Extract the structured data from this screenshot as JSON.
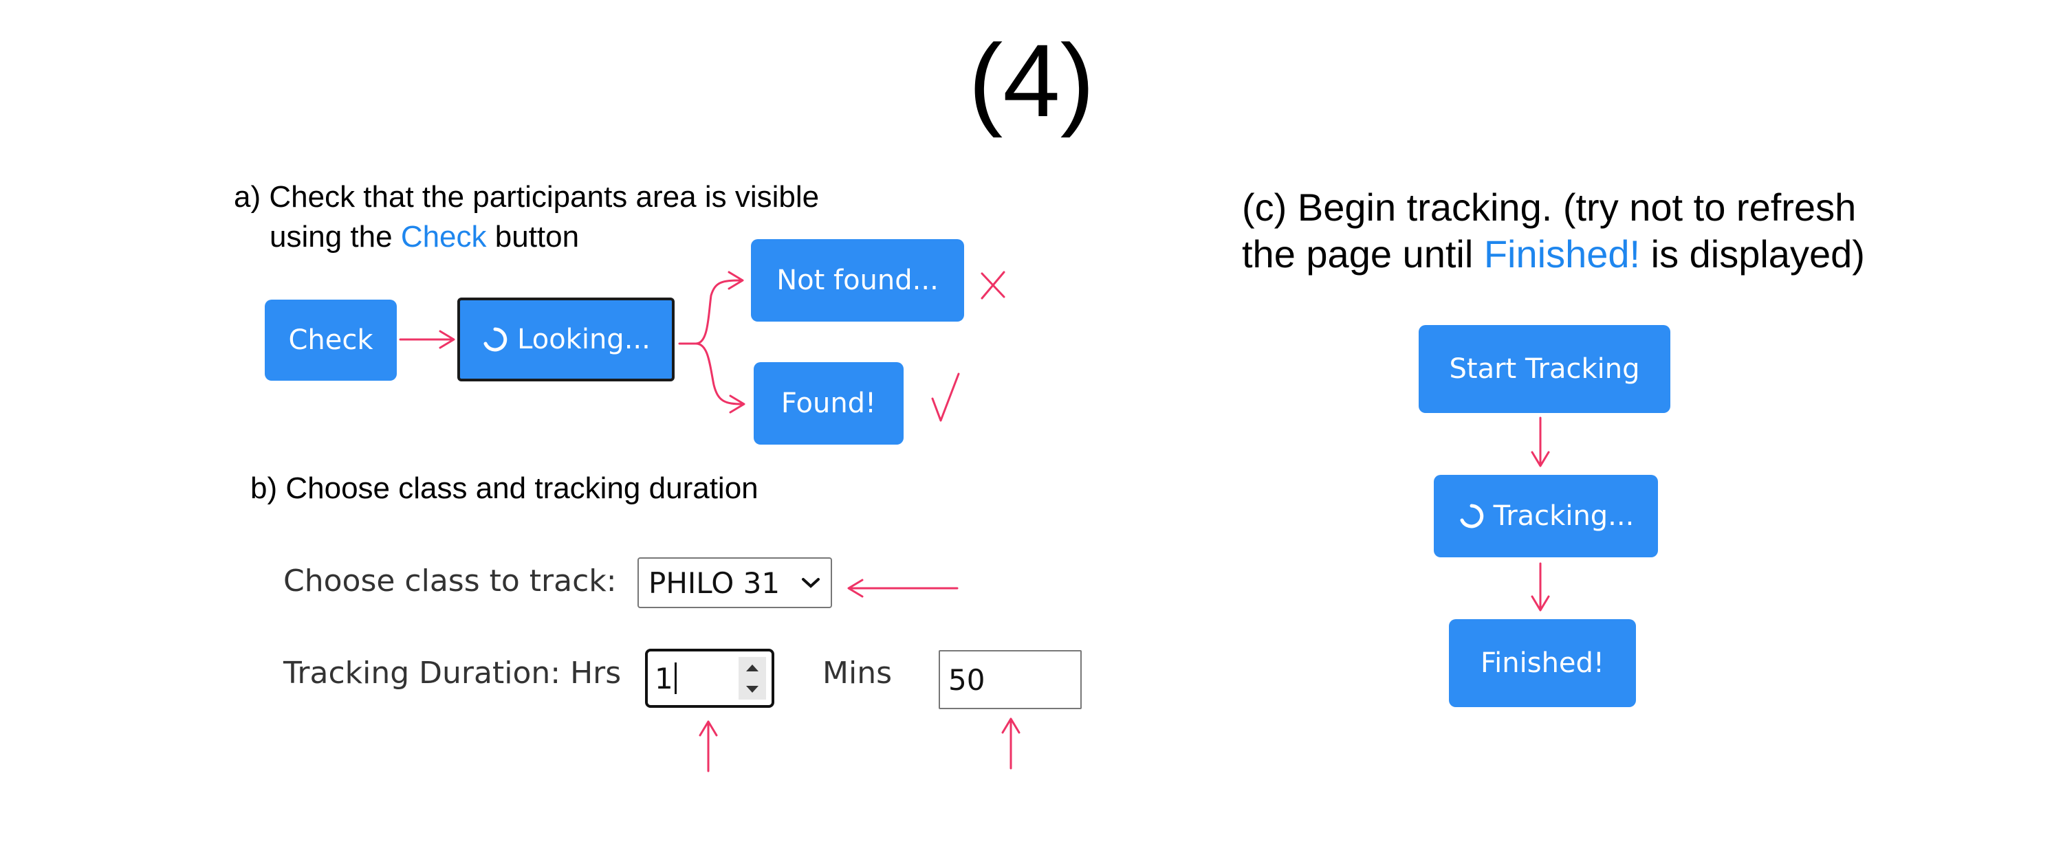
{
  "step_number": "(4)",
  "section_a": {
    "line1": "a) Check that the participants area is visible",
    "line2_prefix": "using the ",
    "line2_highlight": "Check",
    "line2_suffix": " button",
    "buttons": {
      "check": "Check",
      "looking": "Looking...",
      "not_found": "Not found...",
      "found": "Found!"
    }
  },
  "section_b": {
    "heading": "b) Choose class and tracking duration",
    "class_label": "Choose class to track:",
    "class_selected": "PHILO 31",
    "duration_label": "Tracking Duration: Hrs",
    "hours_value": "1",
    "mins_label": "Mins",
    "mins_value": "50"
  },
  "section_c": {
    "line1": "(c) Begin tracking. (try not to refresh",
    "line2_prefix": "the page until ",
    "line2_highlight": "Finished!",
    "line2_suffix": " is displayed)",
    "buttons": {
      "start": "Start Tracking",
      "tracking": "Tracking...",
      "finished": "Finished!"
    }
  },
  "colors": {
    "button_blue": "#2e8df4",
    "highlight_blue": "#1e86ee",
    "annotation_pink": "#ee3366"
  },
  "icons": {
    "spinner": "spinner-icon",
    "not_found_mark": "cross-mark-icon",
    "found_mark": "check-mark-icon"
  }
}
